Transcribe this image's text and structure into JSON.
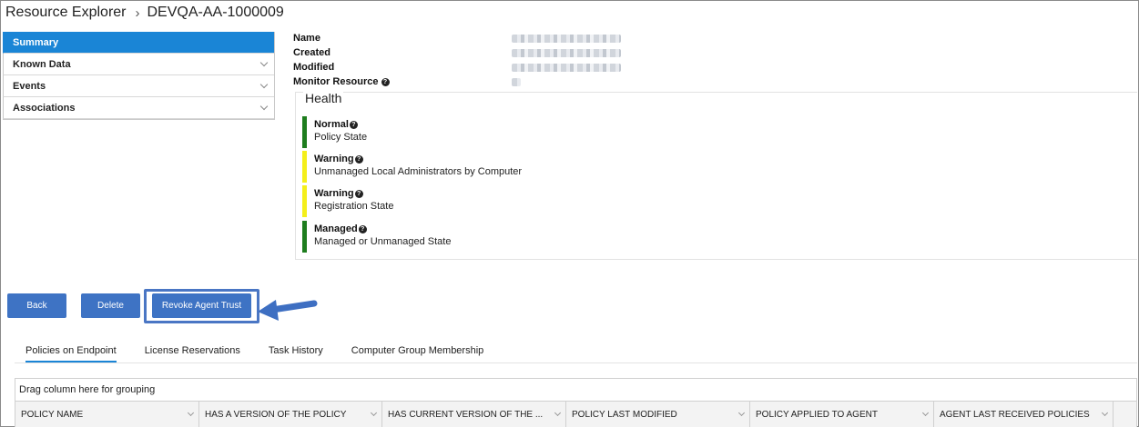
{
  "header": {
    "title": "Resource Explorer",
    "separator": "›",
    "resource": "DEVQA-AA-1000009"
  },
  "sidebar": {
    "items": [
      {
        "label": "Summary",
        "active": true
      },
      {
        "label": "Known Data",
        "active": false
      },
      {
        "label": "Events",
        "active": false
      },
      {
        "label": "Associations",
        "active": false
      }
    ]
  },
  "properties": {
    "name_label": "Name",
    "created_label": "Created",
    "modified_label": "Modified",
    "monitor_label": "Monitor Resource"
  },
  "health": {
    "title": "Health",
    "items": [
      {
        "status": "Normal",
        "description": "Policy State",
        "color": "#1e7d1e"
      },
      {
        "status": "Warning",
        "description": "Unmanaged Local Administrators by Computer",
        "color": "#f4ef1a"
      },
      {
        "status": "Warning",
        "description": "Registration State",
        "color": "#f4ef1a"
      },
      {
        "status": "Managed",
        "description": "Managed or Unmanaged State",
        "color": "#1e7d1e"
      }
    ]
  },
  "actions": {
    "back_label": "Back",
    "delete_label": "Delete",
    "revoke_label": "Revoke Agent Trust"
  },
  "tabs": [
    {
      "label": "Policies on Endpoint",
      "active": true
    },
    {
      "label": "License Reservations",
      "active": false
    },
    {
      "label": "Task History",
      "active": false
    },
    {
      "label": "Computer Group Membership",
      "active": false
    }
  ],
  "grid": {
    "group_hint": "Drag column here for grouping",
    "columns": [
      "POLICY NAME",
      "HAS A VERSION OF THE POLICY",
      "HAS CURRENT VERSION OF THE ...",
      "POLICY LAST MODIFIED",
      "POLICY APPLIED TO AGENT",
      "AGENT LAST RECEIVED POLICIES"
    ]
  },
  "colors": {
    "accent": "#1a85d6",
    "button": "#3e73c4",
    "normal": "#1e7d1e",
    "warning": "#f4ef1a"
  }
}
